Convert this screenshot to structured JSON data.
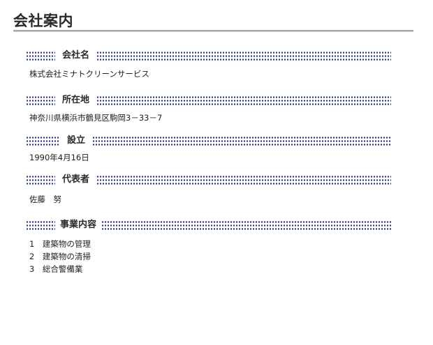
{
  "page": {
    "title": "会社案内"
  },
  "sections": [
    {
      "label": "会社名",
      "lines": [
        "株式会社ミナトクリーンサービス"
      ]
    },
    {
      "label": "所在地",
      "lines": [
        "神奈川県横浜市鶴見区駒岡3－33－7"
      ]
    },
    {
      "label": "設立",
      "lines": [
        "1990年4月16日"
      ]
    },
    {
      "label": "代表者",
      "lines": [
        "佐藤　努"
      ]
    },
    {
      "label": "事業内容",
      "lines": [
        "1　建築物の管理",
        "2　建築物の清掃",
        "3　総合警備業"
      ]
    }
  ],
  "colors": {
    "dot_color": "#1f2a8c",
    "rule_color": "#a7a7a7"
  }
}
